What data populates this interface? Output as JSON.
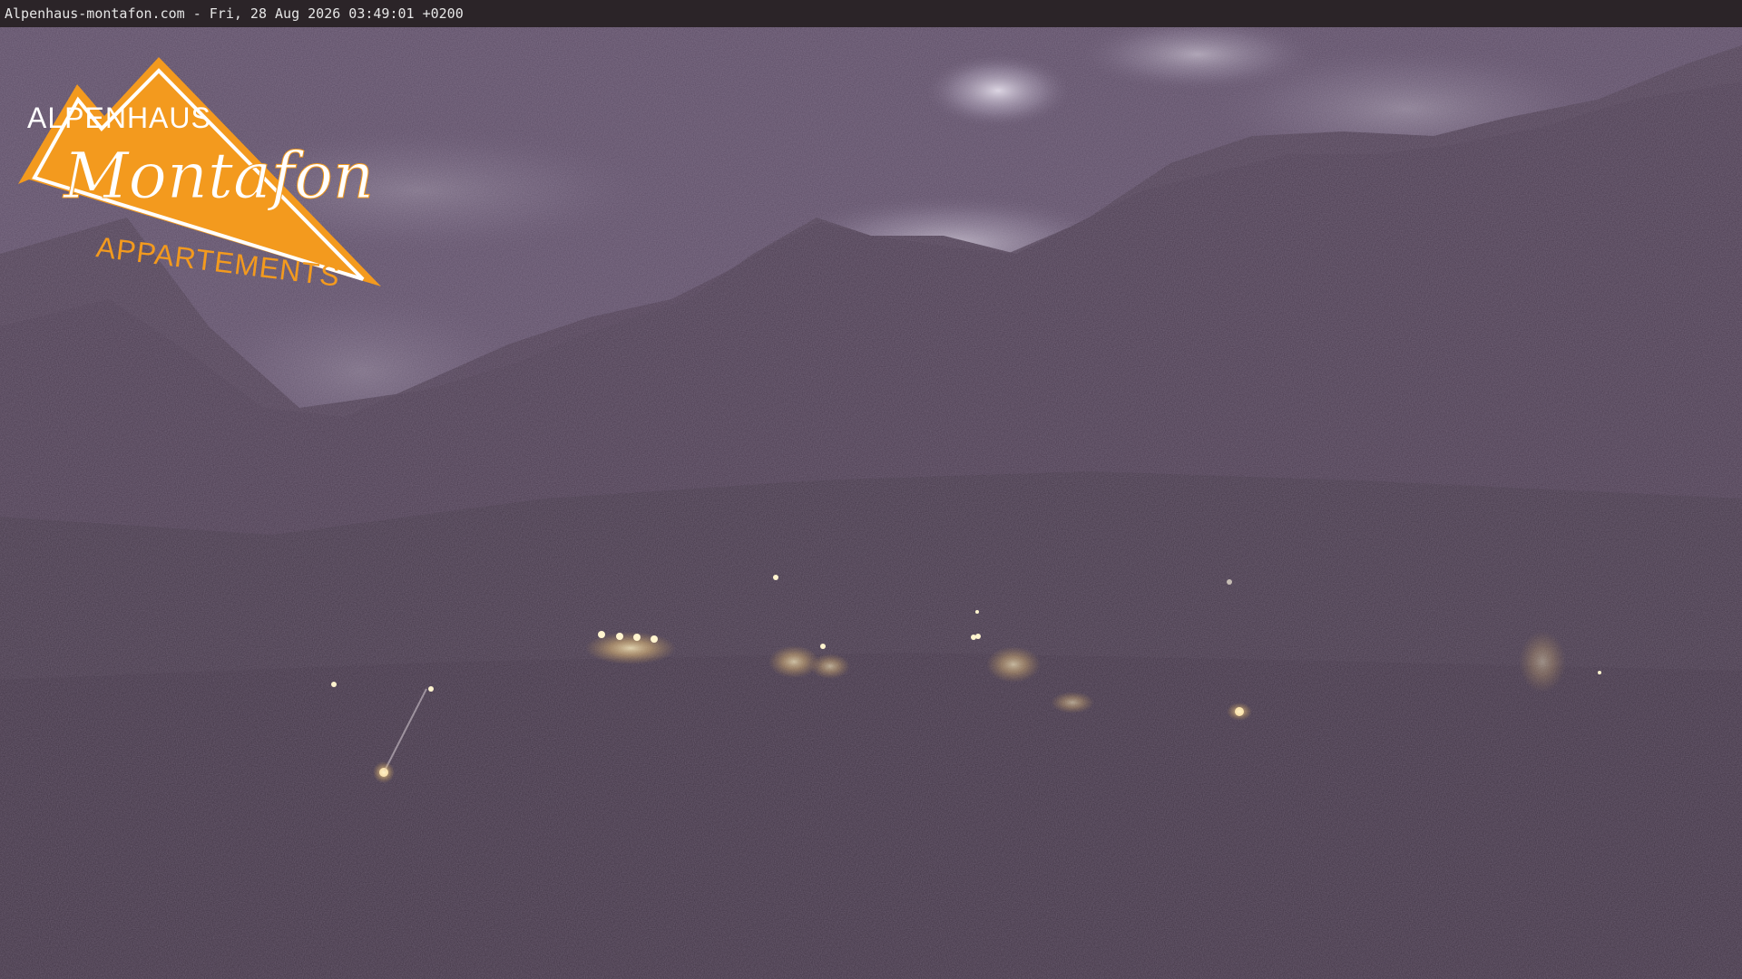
{
  "overlay": {
    "timestamp_text": "Alpenhaus-montafon.com - Fri, 28 Aug 2026 03:49:01 +0200"
  },
  "logo": {
    "line1": "ALPENHAUS",
    "line2": "Montafon",
    "line3": "APPARTEMENTS",
    "color": "#f39a1e"
  },
  "scene": {
    "description_colors": {
      "sky": "#5a4b62",
      "mountain": "#4a3c4e",
      "valley": "#3d3142",
      "light": "#f5d98a"
    }
  }
}
